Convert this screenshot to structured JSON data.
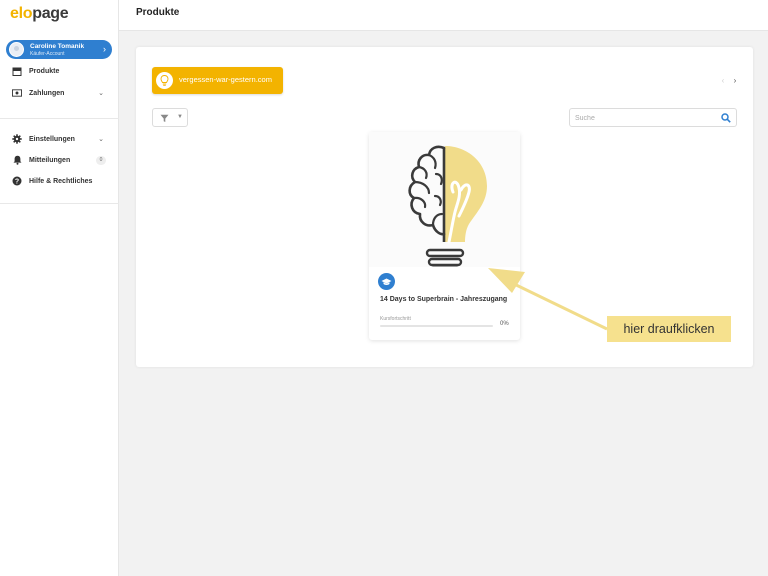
{
  "app": {
    "logo_part1": "elo",
    "logo_part2": "page"
  },
  "user": {
    "name": "Caroline Tomanik",
    "subtitle": "Käufer-Account"
  },
  "sidebar": {
    "items": [
      {
        "label": "Produkte",
        "icon": "store-icon"
      },
      {
        "label": "Zahlungen",
        "icon": "money-icon",
        "expandable": true
      },
      {
        "label": "Einstellungen",
        "icon": "gear-icon",
        "expandable": true
      },
      {
        "label": "Mitteilungen",
        "icon": "bell-icon",
        "badge": "0"
      },
      {
        "label": "Hilfe & Rechtliches",
        "icon": "help-icon"
      }
    ]
  },
  "header": {
    "title": "Produkte"
  },
  "shop": {
    "name": "vergessen-war-gestern.com"
  },
  "search": {
    "placeholder": "Suche",
    "value": ""
  },
  "product": {
    "title": "14 Days to Superbrain - Jahreszugang",
    "subtitle": "Kursfortschritt",
    "progress_percent": 0,
    "progress_label": "0%"
  },
  "annotation": {
    "text": "hier draufklicken"
  },
  "colors": {
    "brand": "#f3b300",
    "accent": "#2f7fd0",
    "annotation": "#f6e18e"
  }
}
